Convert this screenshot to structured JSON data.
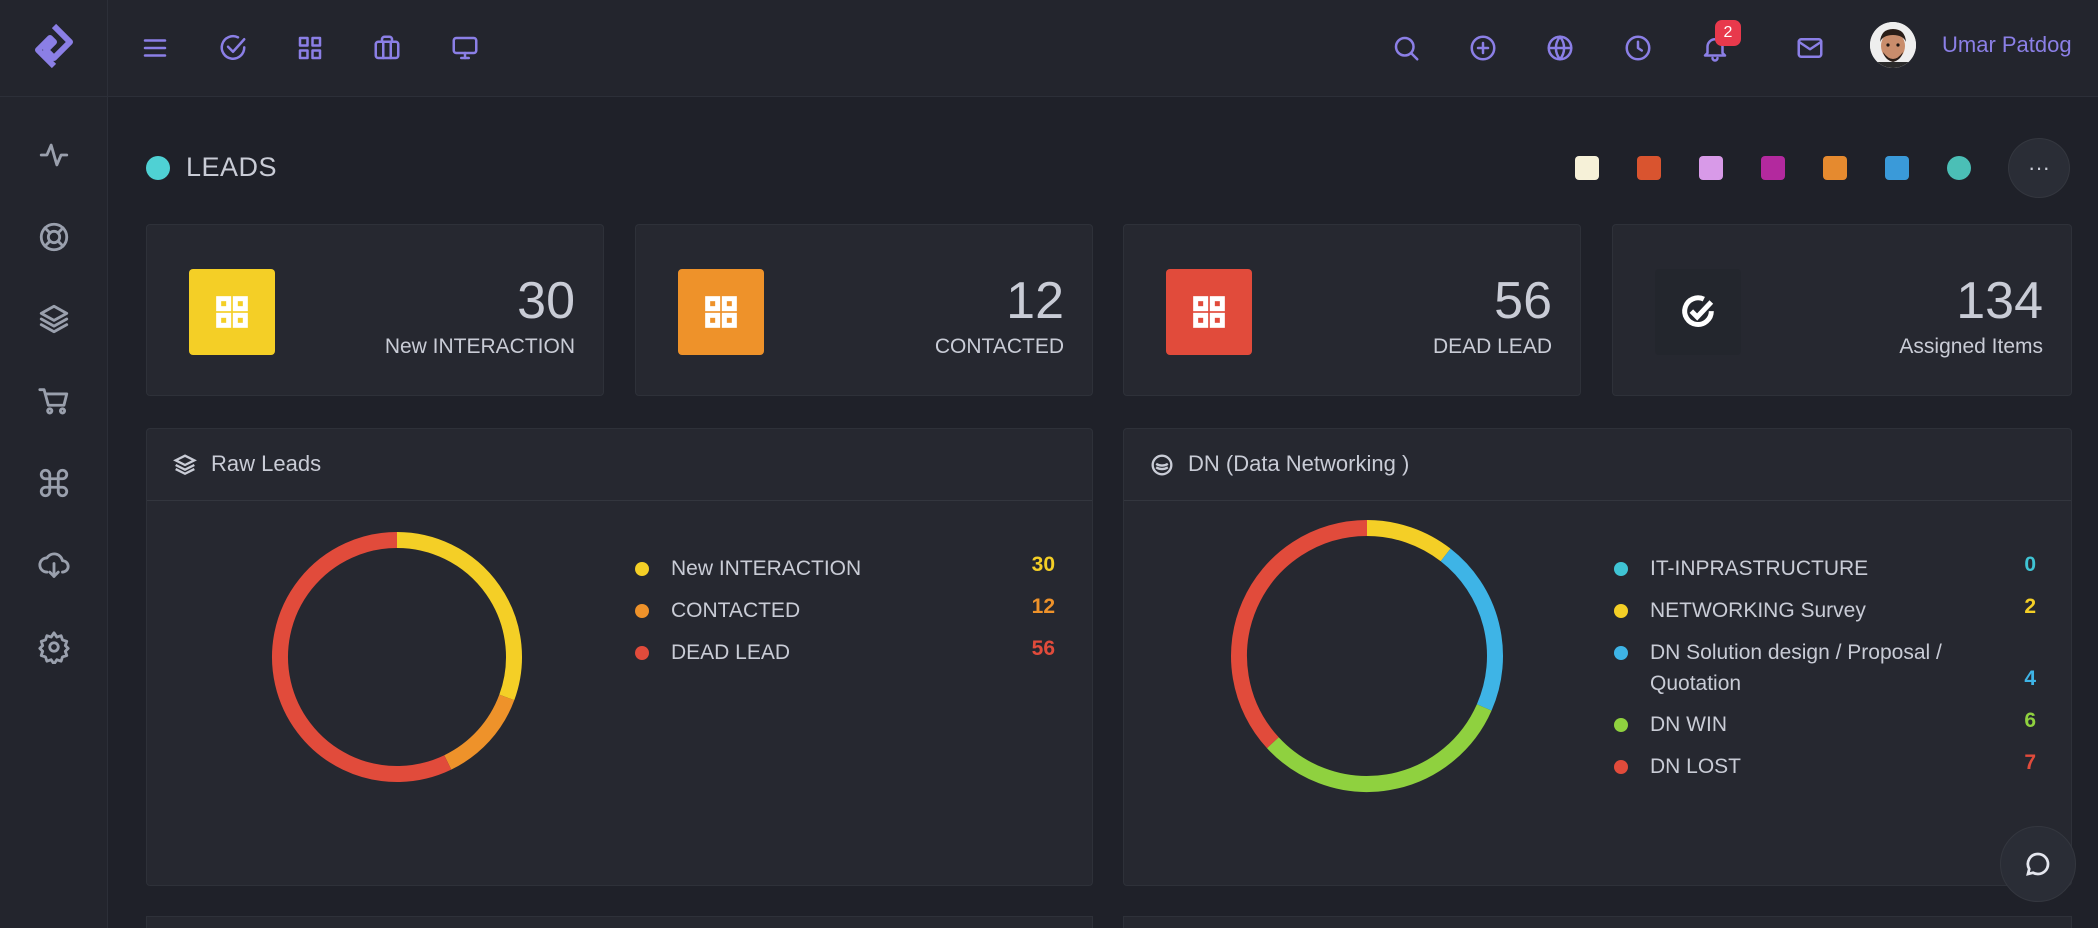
{
  "header": {
    "notification_count": "2",
    "user_name": "Umar Patdog"
  },
  "page": {
    "title": "LEADS",
    "title_dot_color": "#4fd1d4",
    "theme_swatches": [
      "#f6f1d8",
      "#d9542f",
      "#d89ae8",
      "#b3299e",
      "#e58a2f",
      "#3a9ad9",
      "#4bbfb6"
    ]
  },
  "stats": [
    {
      "value": "30",
      "label": "New INTERACTION",
      "color": "#f4cf26",
      "icon": "grid-icon"
    },
    {
      "value": "12",
      "label": "CONTACTED",
      "color": "#ee922a",
      "icon": "grid-icon"
    },
    {
      "value": "56",
      "label": "DEAD LEAD",
      "color": "#e14b3b",
      "icon": "grid-icon"
    },
    {
      "value": "134",
      "label": "Assigned Items",
      "color": "#23262d",
      "icon": "check-circle-icon"
    }
  ],
  "panels": {
    "raw_leads": {
      "title": "Raw Leads",
      "icon": "layers-icon"
    },
    "dn": {
      "title": "DN (Data Networking )",
      "icon": "coins-icon"
    }
  },
  "chart_data": [
    {
      "type": "pie",
      "categories": [
        "New INTERACTION",
        "CONTACTED",
        "DEAD LEAD"
      ],
      "values": [
        30,
        12,
        56
      ],
      "colors": [
        "#f4cf26",
        "#ee922a",
        "#e14b3b"
      ]
    },
    {
      "type": "pie",
      "categories": [
        "IT-INPRASTRUCTURE",
        "NETWORKING Survey",
        "DN Solution design / Proposal / Quotation",
        "DN WIN",
        "DN LOST"
      ],
      "values": [
        0,
        2,
        4,
        6,
        7
      ],
      "colors": [
        "#3fc4d4",
        "#f4cf26",
        "#3eb4e6",
        "#8fd13f",
        "#e14b3b"
      ]
    }
  ]
}
